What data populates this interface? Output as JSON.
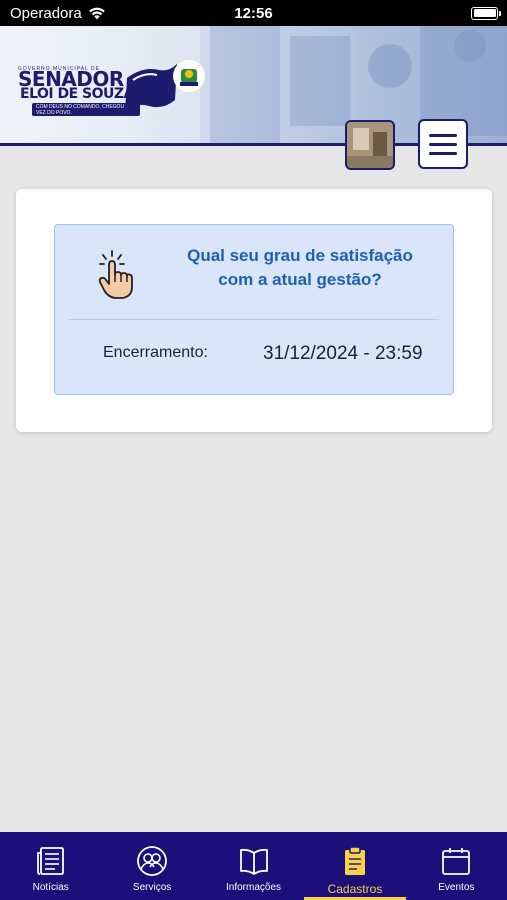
{
  "status_bar": {
    "carrier": "Operadora",
    "time": "12:56"
  },
  "header": {
    "logo": {
      "subtitle": "GOVERNO MUNICIPAL DE",
      "title_line1": "SENADOR",
      "title_line2": "ELOI DE SOUZA",
      "slogan": "COM DEUS NO COMANDO, CHEGOU A VEZ DO POVO."
    }
  },
  "poll": {
    "question": "Qual seu grau de satisfação com a atual gestão?",
    "closing_label": "Encerramento:",
    "closing_date": "31/12/2024 - 23:59"
  },
  "tabbar": {
    "active": "Cadastros",
    "tabs": [
      {
        "label": "Notícias",
        "icon": "newspaper-icon"
      },
      {
        "label": "Serviços",
        "icon": "users-circle-icon"
      },
      {
        "label": "Informações",
        "icon": "book-open-icon"
      },
      {
        "label": "Cadastros",
        "icon": "clipboard-icon"
      },
      {
        "label": "Eventos",
        "icon": "calendar-icon"
      }
    ]
  },
  "colors": {
    "brand": "#1c0f7a",
    "accent": "#f5d24a",
    "link": "#1f5fb3",
    "poll_bg": "#d9e6fa"
  }
}
